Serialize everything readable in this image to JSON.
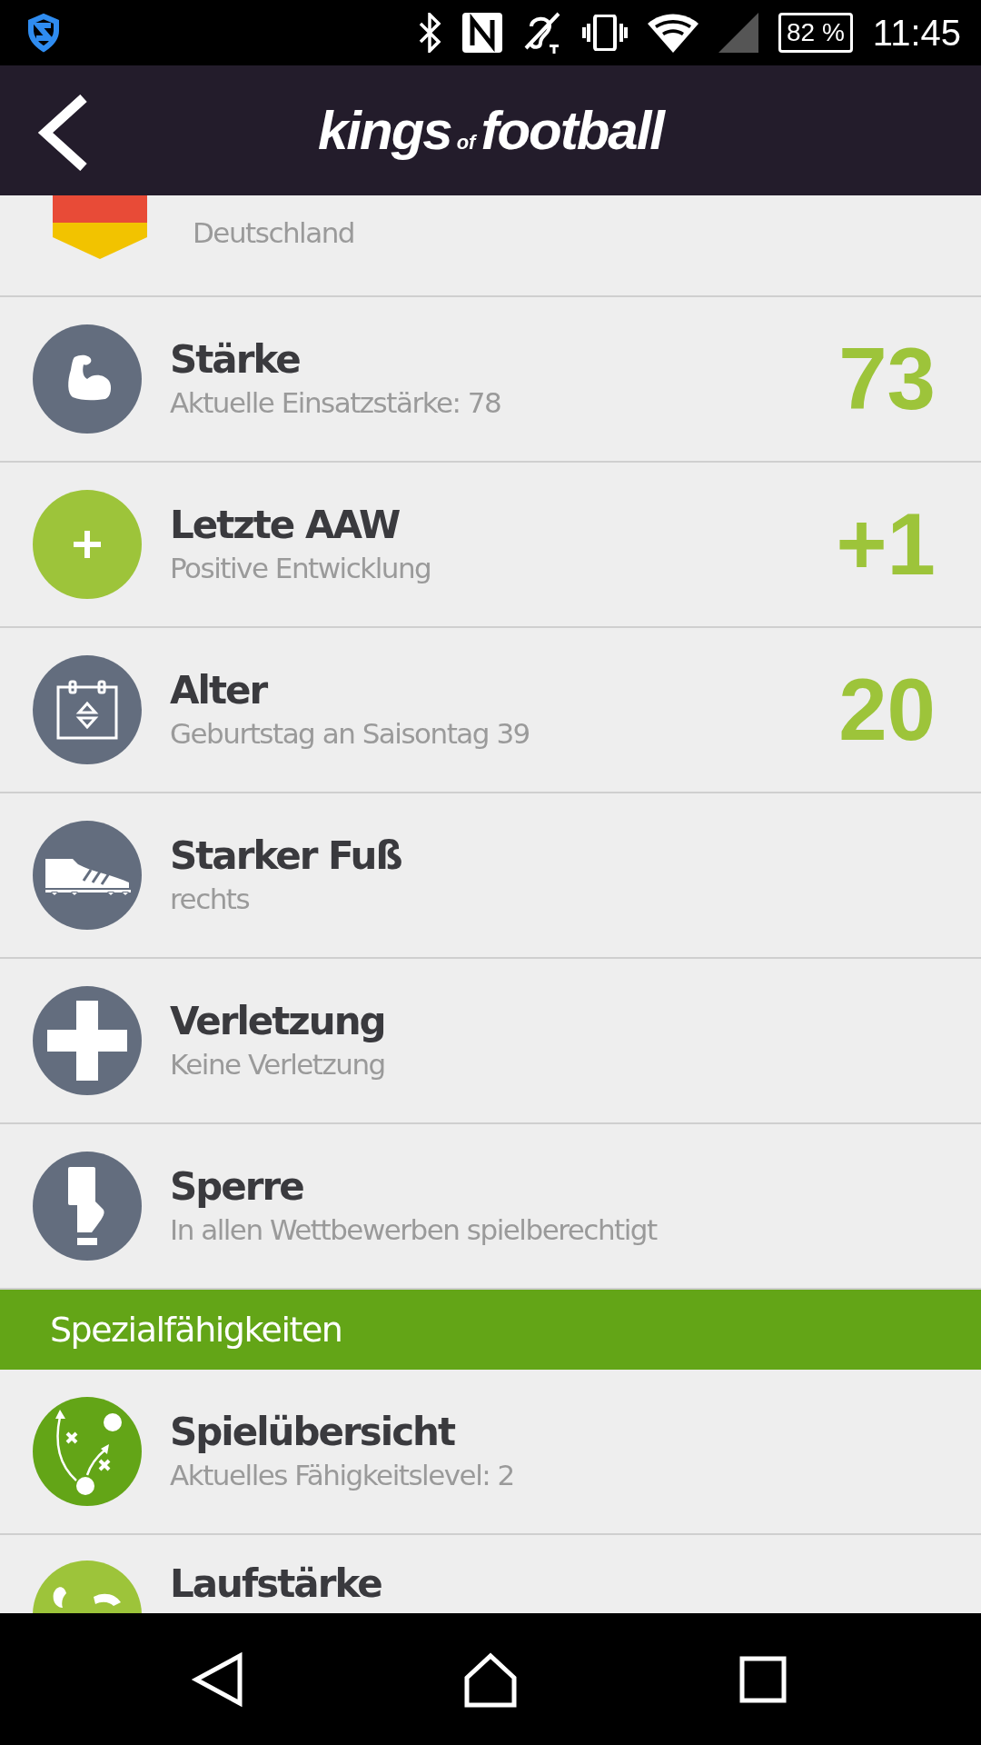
{
  "status_bar": {
    "battery": "82 %",
    "time": "11:45"
  },
  "header": {
    "logo": [
      "kings",
      "of",
      "football"
    ]
  },
  "top_row": {
    "subtitle": "Deutschland"
  },
  "rows": [
    {
      "title": "Stärke",
      "subtitle": "Aktuelle Einsatzstärke: 78",
      "value": "73",
      "color": "#636d7e"
    },
    {
      "title": "Letzte AAW",
      "subtitle": "Positive Entwicklung",
      "value": "+1",
      "color": "#9dc43a"
    },
    {
      "title": "Alter",
      "subtitle": "Geburtstag an Saisontag 39",
      "value": "20",
      "color": "#636d7e"
    },
    {
      "title": "Starker Fuß",
      "subtitle": "rechts",
      "color": "#636d7e"
    },
    {
      "title": "Verletzung",
      "subtitle": "Keine Verletzung",
      "color": "#636d7e"
    },
    {
      "title": "Sperre",
      "subtitle": "In allen Wettbewerben spielberechtigt",
      "color": "#636d7e"
    }
  ],
  "section": {
    "title": "Spezialfähigkeiten"
  },
  "skills": [
    {
      "title": "Spielübersicht",
      "subtitle": "Aktuelles Fähigkeitslevel: 2",
      "color": "#63a517"
    },
    {
      "title": "Laufstärke",
      "color": "#9dc43a"
    }
  ]
}
